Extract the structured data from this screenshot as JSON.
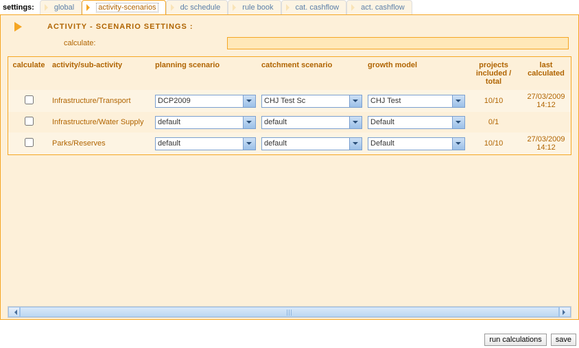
{
  "settings_label": "settings:",
  "tabs": [
    {
      "label": "global",
      "active": false
    },
    {
      "label": "activity-scenarios",
      "active": true
    },
    {
      "label": "dc schedule",
      "active": false
    },
    {
      "label": "rule book",
      "active": false
    },
    {
      "label": "cat. cashflow",
      "active": false
    },
    {
      "label": "act. cashflow",
      "active": false
    }
  ],
  "page_title": "ACTIVITY - SCENARIO SETTINGS :",
  "calculate_label": "calculate:",
  "calculate_value": "",
  "columns": {
    "calculate": "calculate",
    "activity": "activity/sub-activity",
    "planning": "planning scenario",
    "catchment": "catchment scenario",
    "growth": "growth model",
    "projects": "projects included / total",
    "last": "last calculated"
  },
  "rows": [
    {
      "activity": "Infrastructure/Transport",
      "planning": "DCP2009",
      "catchment": "CHJ Test Sc",
      "growth": "CHJ Test",
      "projects": "10/10",
      "last": "27/03/2009 14:12"
    },
    {
      "activity": "Infrastructure/Water Supply",
      "planning": "default",
      "catchment": "default",
      "growth": "Default",
      "projects": "0/1",
      "last": ""
    },
    {
      "activity": "Parks/Reserves",
      "planning": "default",
      "catchment": "default",
      "growth": "Default",
      "projects": "10/10",
      "last": "27/03/2009 14:12"
    }
  ],
  "buttons": {
    "run": "run calculations",
    "save": "save"
  }
}
